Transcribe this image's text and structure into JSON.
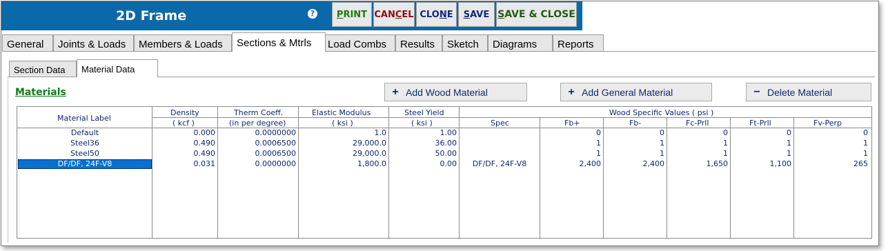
{
  "app": {
    "title": "2D Frame",
    "help_icon": "?"
  },
  "toolbar": {
    "print_pre": "",
    "print_hot": "P",
    "print_post": "RINT",
    "cancel_pre": "CAN",
    "cancel_hot": "C",
    "cancel_post": "EL",
    "clone_pre": "CLO",
    "clone_hot": "N",
    "clone_post": "E",
    "save_pre": "",
    "save_hot": "S",
    "save_post": "AVE",
    "saveclose_pre": "",
    "saveclose_hot": "S",
    "saveclose_post": "AVE & CLOSE"
  },
  "tabs": [
    "General",
    "Joints & Loads",
    "Members & Loads",
    "Sections & Mtrls",
    "Load Combs",
    "Results",
    "Sketch",
    "Diagrams",
    "Reports"
  ],
  "subtabs": [
    "Section Data",
    "Material Data"
  ],
  "materials_title": "Materials",
  "buttons": {
    "add_wood": "Add Wood Material",
    "add_general": "Add General Material",
    "delete": "Delete Material"
  },
  "table": {
    "headers": {
      "label": "Material Label",
      "density": "Density",
      "density_unit": "( kcf )",
      "therm": "Therm Coeff.",
      "therm_unit": "(in per degree)",
      "elastic": "Elastic Modulus",
      "elastic_unit": "( ksi )",
      "yield": "Steel Yield",
      "yield_unit": "( ksi )",
      "wood": "Wood Specific Values    ( psi )",
      "spec": "Spec",
      "fb_plus": "Fb+",
      "fb_minus": "Fb-",
      "fc": "Fc-Prll",
      "ft": "Ft-Prll",
      "fv": "Fv-Perp"
    },
    "rows": [
      {
        "label": "Default",
        "density": "0.000",
        "therm": "0.0000000",
        "elastic": "1.0",
        "yield": "1.00",
        "spec": "",
        "fb_plus": "0",
        "fb_minus": "0",
        "fc": "0",
        "ft": "0",
        "fv": "0"
      },
      {
        "label": "Steel36",
        "density": "0.490",
        "therm": "0.0006500",
        "elastic": "29,000.0",
        "yield": "36.00",
        "spec": "",
        "fb_plus": "1",
        "fb_minus": "1",
        "fc": "1",
        "ft": "1",
        "fv": "1"
      },
      {
        "label": "Steel50",
        "density": "0.490",
        "therm": "0.0006500",
        "elastic": "29,000.0",
        "yield": "50.00",
        "spec": "",
        "fb_plus": "1",
        "fb_minus": "1",
        "fc": "1",
        "ft": "1",
        "fv": "1"
      },
      {
        "label": "DF/DF, 24F-V8",
        "density": "0.031",
        "therm": "0.0000000",
        "elastic": "1,800.0",
        "yield": "0.00",
        "spec": "DF/DF, 24F-V8",
        "fb_plus": "2,400",
        "fb_minus": "2,400",
        "fc": "1,650",
        "ft": "1,100",
        "fv": "265"
      }
    ],
    "selected_row": 3
  },
  "colors": {
    "header_bg": "#0a69a8",
    "selection": "#0b6fd0",
    "materials_green": "#137a14"
  }
}
